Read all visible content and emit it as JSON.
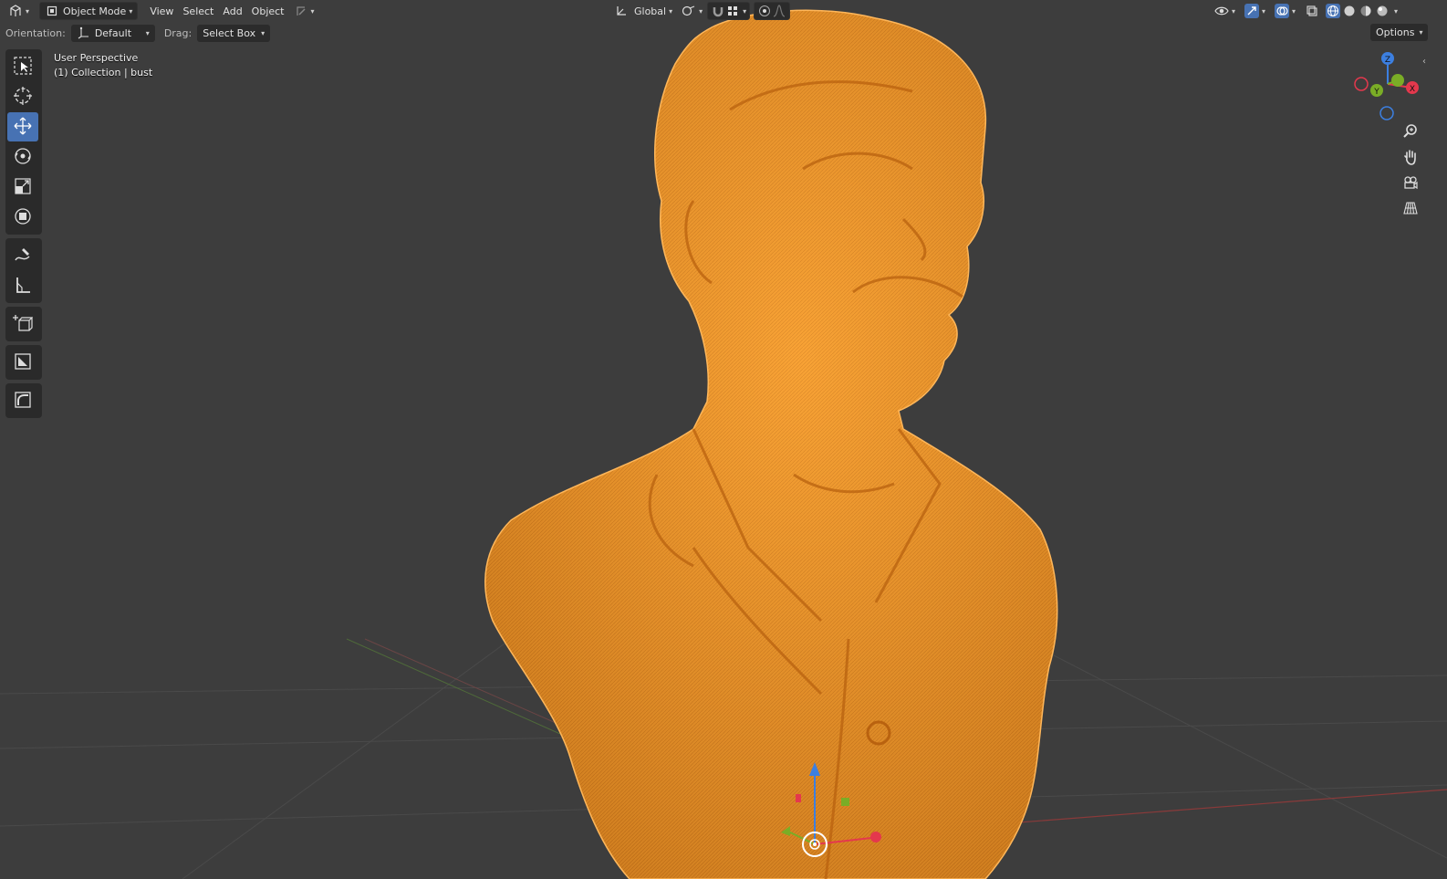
{
  "header": {
    "mode": "Object Mode",
    "menu": [
      "View",
      "Select",
      "Add",
      "Object"
    ],
    "transform_orientation": "Global",
    "options": "Options"
  },
  "toolsettings": {
    "orientation_label": "Orientation:",
    "orientation_value": "Default",
    "drag_label": "Drag:",
    "drag_value": "Select Box"
  },
  "viewport": {
    "view_name": "User Perspective",
    "collection_info": "(1) Collection | bust"
  },
  "toolbar": {
    "tools": [
      "select-box-icon",
      "cursor-icon",
      "move-icon",
      "rotate-icon",
      "scale-icon",
      "transform-icon",
      "annotate-icon",
      "measure-icon",
      "add-cube-icon",
      "inset-icon",
      "bevel-icon"
    ],
    "active": "move-icon"
  },
  "gizmo": {
    "axes": [
      "X",
      "Y",
      "Z"
    ],
    "colors": {
      "x": "#e4384d",
      "y": "#7aad26",
      "z": "#3c7fe0"
    }
  },
  "colors": {
    "selection_orange": "#f59a2c",
    "background": "#3d3d3d",
    "accent_blue": "#4772b3"
  }
}
